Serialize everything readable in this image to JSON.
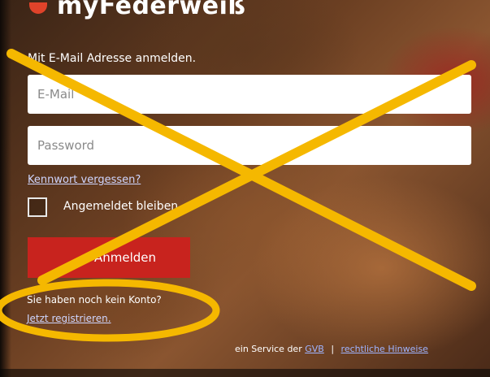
{
  "header": {
    "app_title": "myFederweiß"
  },
  "login": {
    "instruction": "Mit E-Mail Adresse anmelden.",
    "email_placeholder": "E-Mail",
    "password_placeholder": "Password",
    "forgot_password": "Kennwort vergessen?",
    "stay_logged_in": "Angemeldet bleiben",
    "login_button": "Anmelden"
  },
  "signup": {
    "question": "Sie haben noch kein Konto?",
    "register_link": "Jetzt registrieren."
  },
  "footer": {
    "prefix": "ein Service der",
    "gvb_link": "GVB",
    "separator": "|",
    "legal_link": "rechtliche Hinweise"
  },
  "annotations": {
    "cross_color": "#f5b800",
    "ellipse_color": "#f5b800"
  }
}
